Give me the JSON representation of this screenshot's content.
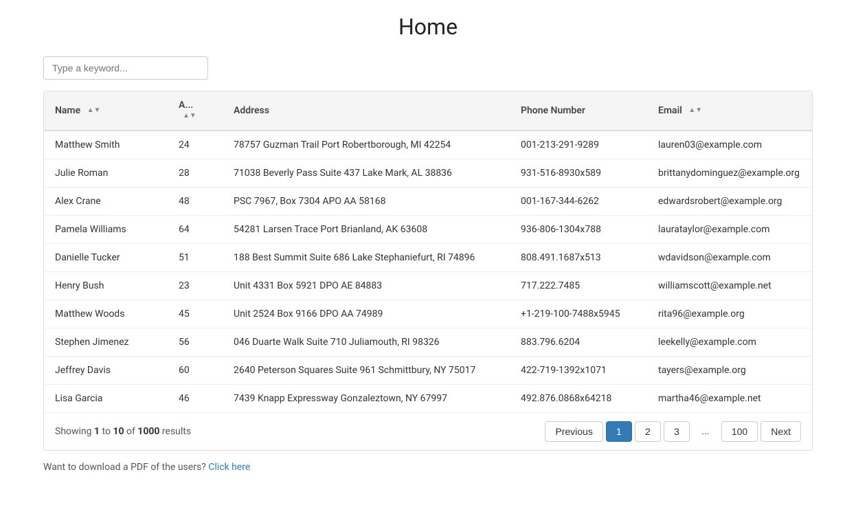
{
  "page": {
    "title": "Home",
    "search_placeholder": "Type a keyword...",
    "download_text": "Want to download a PDF of the users?",
    "download_link_label": "Click here"
  },
  "table": {
    "columns": [
      {
        "key": "name",
        "label": "Name",
        "sortable": true
      },
      {
        "key": "age",
        "label": "A...",
        "sortable": true
      },
      {
        "key": "address",
        "label": "Address",
        "sortable": false
      },
      {
        "key": "phone",
        "label": "Phone Number",
        "sortable": false
      },
      {
        "key": "email",
        "label": "Email",
        "sortable": true
      }
    ],
    "rows": [
      {
        "name": "Matthew Smith",
        "age": "24",
        "address": "78757 Guzman Trail Port Robertborough, MI 42254",
        "phone": "001-213-291-9289",
        "email": "lauren03@example.com"
      },
      {
        "name": "Julie Roman",
        "age": "28",
        "address": "71038 Beverly Pass Suite 437 Lake Mark, AL 38836",
        "phone": "931-516-8930x589",
        "email": "brittanydominguez@example.org"
      },
      {
        "name": "Alex Crane",
        "age": "48",
        "address": "PSC 7967, Box 7304 APO AA 58168",
        "phone": "001-167-344-6262",
        "email": "edwardsrobert@example.org"
      },
      {
        "name": "Pamela Williams",
        "age": "64",
        "address": "54281 Larsen Trace Port Brianland, AK 63608",
        "phone": "936-806-1304x788",
        "email": "laurataylor@example.com"
      },
      {
        "name": "Danielle Tucker",
        "age": "51",
        "address": "188 Best Summit Suite 686 Lake Stephaniefurt, RI 74896",
        "phone": "808.491.1687x513",
        "email": "wdavidson@example.com"
      },
      {
        "name": "Henry Bush",
        "age": "23",
        "address": "Unit 4331 Box 5921 DPO AE 84883",
        "phone": "717.222.7485",
        "email": "williamscott@example.net"
      },
      {
        "name": "Matthew Woods",
        "age": "45",
        "address": "Unit 2524 Box 9166 DPO AA 74989",
        "phone": "+1-219-100-7488x5945",
        "email": "rita96@example.org"
      },
      {
        "name": "Stephen Jimenez",
        "age": "56",
        "address": "046 Duarte Walk Suite 710 Juliamouth, RI 98326",
        "phone": "883.796.6204",
        "email": "leekelly@example.com"
      },
      {
        "name": "Jeffrey Davis",
        "age": "60",
        "address": "2640 Peterson Squares Suite 961 Schmittbury, NY 75017",
        "phone": "422-719-1392x1071",
        "email": "tayers@example.org"
      },
      {
        "name": "Lisa Garcia",
        "age": "46",
        "address": "7439 Knapp Expressway Gonzaleztown, NY 67997",
        "phone": "492.876.0868x64218",
        "email": "martha46@example.net"
      }
    ]
  },
  "pagination": {
    "showing_prefix": "Showing ",
    "showing_from": "1",
    "showing_to": "10",
    "showing_total": "1000",
    "showing_suffix": " results",
    "previous_label": "Previous",
    "next_label": "Next",
    "pages": [
      "1",
      "2",
      "3",
      "...",
      "100"
    ],
    "active_page": "1"
  }
}
